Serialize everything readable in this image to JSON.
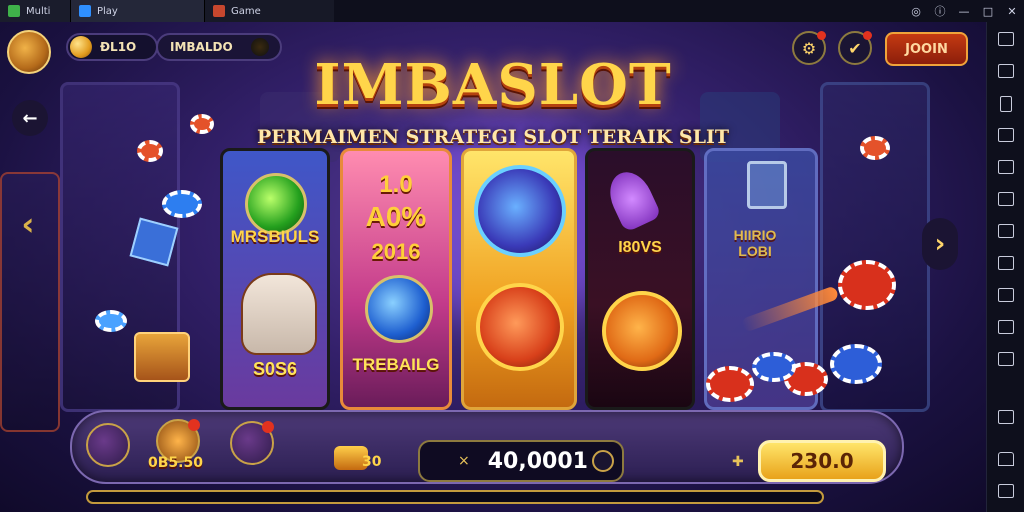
{
  "tabs": [
    {
      "label": "Multi"
    },
    {
      "label": "Play"
    },
    {
      "label": "Game"
    }
  ],
  "window_controls": [
    "◎",
    "ⓘ",
    "—",
    "□",
    "✕"
  ],
  "header": {
    "coins": "ĐL1O",
    "username": "IMBALDO",
    "shop_button": "JOOIN"
  },
  "title": "IMBASLOT",
  "subtitle": "PERMAIMEN STRATEGI SLOT TERAIK SLIT",
  "cards": [
    {
      "top": "MRSBIULS",
      "bottom": "S0S6"
    },
    {
      "top": "1.0",
      "middle": "A0%",
      "lower": "2016",
      "bottom": "TREBAILG"
    },
    {},
    {
      "middle": "I80VS"
    },
    {
      "middle": "HIIRIO LOBI"
    }
  ],
  "bottom_bar": {
    "item_label": "0B5.50",
    "small_value": "30",
    "balance": "40,0001",
    "bet": "230.0",
    "multiplier_symbol": "×"
  },
  "colors": {
    "title_gold": "#ffd54a",
    "accent_orange": "#e06a16",
    "bg_purple": "#33206a"
  }
}
